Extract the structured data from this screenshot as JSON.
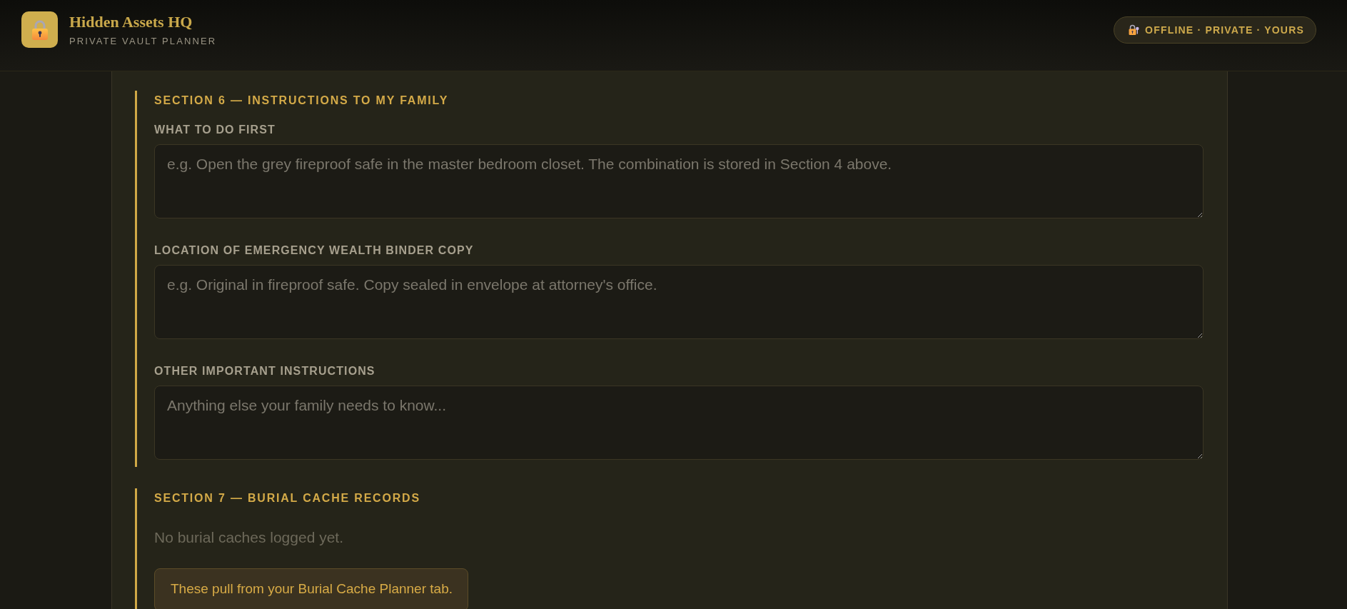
{
  "header": {
    "title": "Hidden Assets HQ",
    "subtitle": "PRIVATE VAULT PLANNER",
    "badge": "OFFLINE · PRIVATE · YOURS"
  },
  "sections": [
    {
      "heading": "SECTION 6 — INSTRUCTIONS TO MY FAMILY",
      "fields": [
        {
          "label": "WHAT TO DO FIRST",
          "placeholder": "e.g. Open the grey fireproof safe in the master bedroom closet. The combination is stored in Section 4 above."
        },
        {
          "label": "LOCATION OF EMERGENCY WEALTH BINDER COPY",
          "placeholder": "e.g. Original in fireproof safe. Copy sealed in envelope at attorney's office."
        },
        {
          "label": "OTHER IMPORTANT INSTRUCTIONS",
          "placeholder": "Anything else your family needs to know..."
        }
      ]
    },
    {
      "heading": "SECTION 7 — BURIAL CACHE RECORDS",
      "empty_text": "No burial caches logged yet.",
      "note": "These pull from your Burial Cache Planner tab."
    }
  ]
}
